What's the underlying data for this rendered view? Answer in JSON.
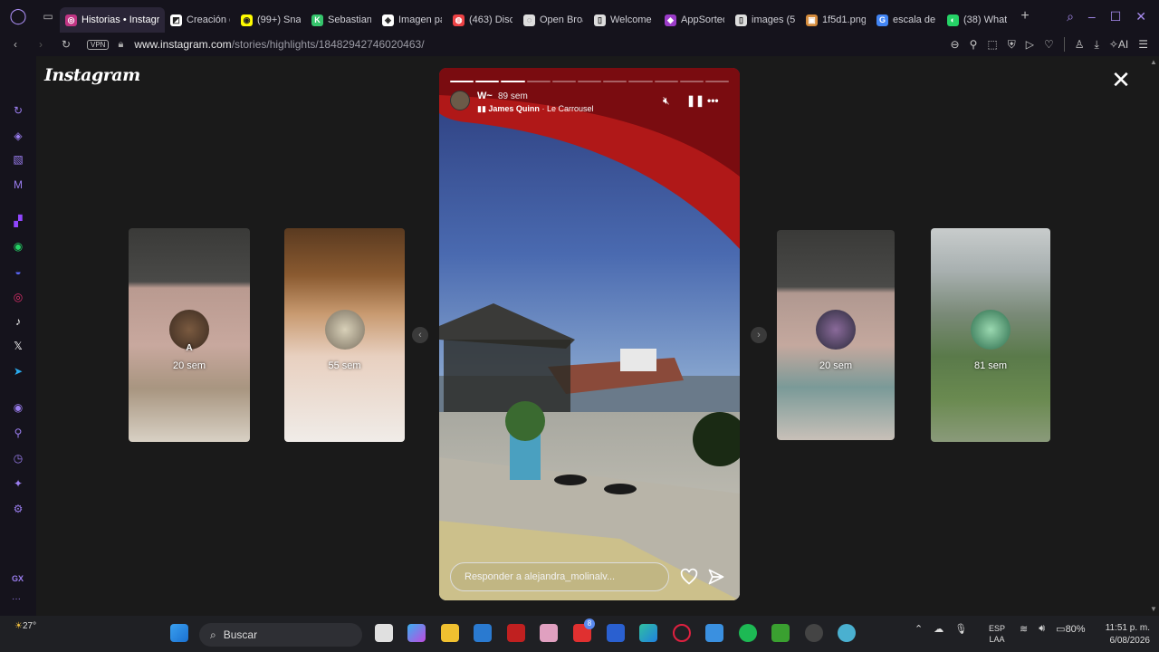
{
  "browser": {
    "tabs": [
      {
        "title": "Historias • Instagr",
        "color": "#c13584",
        "glyph": "◎",
        "active": true
      },
      {
        "title": "Creación d",
        "color": "#ffffff",
        "glyph": "◩"
      },
      {
        "title": "(99+) Sna",
        "color": "#fffc00",
        "glyph": "◉"
      },
      {
        "title": "Sebastian",
        "color": "#35c56c",
        "glyph": "K"
      },
      {
        "title": "Imagen pa",
        "color": "#ffffff",
        "glyph": "◈"
      },
      {
        "title": "(463) Disc",
        "color": "#ed4245",
        "glyph": "◍"
      },
      {
        "title": "Open Broa",
        "color": "#dddddd",
        "glyph": "◌"
      },
      {
        "title": "Welcome",
        "color": "#dddddd",
        "glyph": "▯"
      },
      {
        "title": "AppSorteo",
        "color": "#9b3cc8",
        "glyph": "◆"
      },
      {
        "title": "images (5",
        "color": "#dddddd",
        "glyph": "▯"
      },
      {
        "title": "1f5d1.png",
        "color": "#d48b3c",
        "glyph": "▣"
      },
      {
        "title": "escala de",
        "color": "#4285f4",
        "glyph": "G"
      },
      {
        "title": "(38) What",
        "color": "#25d366",
        "glyph": "◐"
      }
    ],
    "new_tab": "+",
    "url_host": "www.instagram.com",
    "url_path": "/stories/highlights/18482942746020463/",
    "vpn_label": "VPN",
    "ai_label": "AI"
  },
  "sidebar_icons": [
    "reload-icon",
    "aria-icon",
    "workspaces-icon",
    "mail-icon",
    "twitch-icon",
    "whatsapp-icon",
    "discord-icon",
    "instagram-icon",
    "tiktok-icon",
    "x-icon",
    "telegram-icon",
    "player-icon",
    "pin-icon",
    "history-icon",
    "extensions-icon",
    "settings-icon"
  ],
  "sidebar_gx": "GX",
  "sidebar_more": "···",
  "instagram": {
    "logo": "Instagram",
    "story": {
      "username": "W~",
      "time": "89 sem",
      "music_artist": "James Quinn",
      "music_sep": "·",
      "music_song": "Le Carrousel",
      "progress_total": 11,
      "progress_done": 3,
      "reply_placeholder": "Responder a alejandra_molinalv..."
    },
    "thumbs": [
      {
        "name": "A",
        "label": "20 sem"
      },
      {
        "name": "",
        "label": "55 sem"
      },
      {
        "name": "",
        "label": "20 sem"
      },
      {
        "name": "",
        "label": "81 sem"
      }
    ]
  },
  "taskbar": {
    "temp": "27°",
    "search_label": "Buscar",
    "lang_top": "ESP",
    "lang_bottom": "LAA",
    "battery": "80%",
    "time": "11:51 p. m.",
    "date": "6/08/2026",
    "notif_badge": "8"
  }
}
